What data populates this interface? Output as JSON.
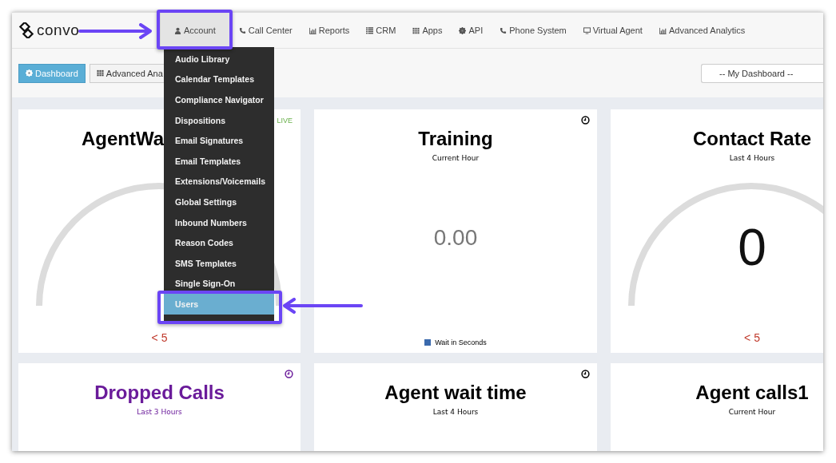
{
  "navbar": {
    "logo": "convo",
    "items": [
      {
        "label": "Account",
        "selected": true
      },
      {
        "label": "Call Center",
        "selected": false
      },
      {
        "label": "Reports",
        "selected": false
      },
      {
        "label": "CRM",
        "selected": false
      },
      {
        "label": "Apps",
        "selected": false
      },
      {
        "label": "API",
        "selected": false
      },
      {
        "label": "Phone System",
        "selected": false
      },
      {
        "label": "Virtual Agent",
        "selected": false
      },
      {
        "label": "Advanced Analytics",
        "selected": false
      }
    ]
  },
  "account_menu": {
    "items": [
      {
        "label": "Audio Library",
        "selected": false
      },
      {
        "label": "Calendar Templates",
        "selected": false
      },
      {
        "label": "Compliance Navigator",
        "selected": false
      },
      {
        "label": "Dispositions",
        "selected": false
      },
      {
        "label": "Email Signatures",
        "selected": false
      },
      {
        "label": "Email Templates",
        "selected": false
      },
      {
        "label": "Extensions/Voicemails",
        "selected": false
      },
      {
        "label": "Global Settings",
        "selected": false
      },
      {
        "label": "Inbound Numbers",
        "selected": false
      },
      {
        "label": "Reason Codes",
        "selected": false
      },
      {
        "label": "SMS Templates",
        "selected": false
      },
      {
        "label": "Single Sign-On",
        "selected": false
      },
      {
        "label": "Users",
        "selected": true
      }
    ]
  },
  "toolbar": {
    "buttons": [
      {
        "label": "Dashboard",
        "selected": true
      },
      {
        "label": "Advanced Ana",
        "selected": false
      }
    ],
    "dashboard_select": {
      "value": "-- My Dashboard --"
    }
  },
  "widgets": [
    {
      "kind": "gauge",
      "title": "AgentWa",
      "color": "#000000",
      "badge": "LIVE",
      "threshold": "< 5"
    },
    {
      "kind": "number",
      "title": "Training",
      "subtitle": "Current Hour",
      "color": "#000000",
      "clock": true,
      "value": "0.00",
      "legend": "Wait in Seconds"
    },
    {
      "kind": "gauge",
      "title": "Contact Rate",
      "subtitle": "Last 4 Hours",
      "color": "#000000",
      "value": "0",
      "threshold": "< 5"
    },
    {
      "kind": "number",
      "title": "Dropped Calls",
      "subtitle": "Last 3 Hours",
      "color": "#6a1b9a",
      "clock": true
    },
    {
      "kind": "number",
      "title": "Agent wait time",
      "subtitle": "Last 4 Hours",
      "color": "#000000",
      "clock": true
    },
    {
      "kind": "number",
      "title": "Agent calls1",
      "subtitle": "Current Hour",
      "color": "#000000"
    }
  ]
}
